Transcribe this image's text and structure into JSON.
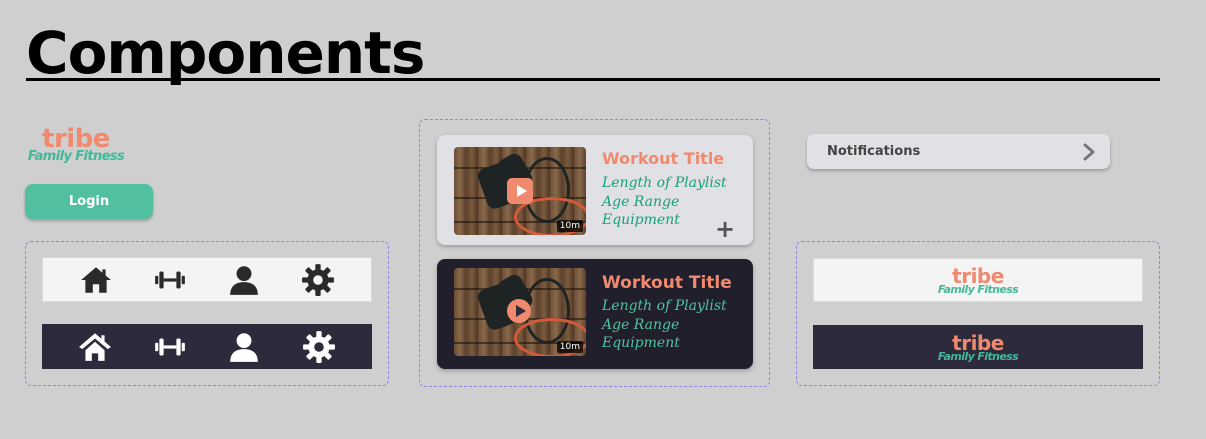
{
  "page": {
    "title": "Components"
  },
  "brand": {
    "name": "tribe",
    "tagline": "Family Fitness"
  },
  "login": {
    "label": "Login"
  },
  "navbar": {
    "items": [
      {
        "icon": "home-icon"
      },
      {
        "icon": "dumbbell-icon"
      },
      {
        "icon": "user-icon"
      },
      {
        "icon": "gear-icon"
      }
    ]
  },
  "workout_cards": [
    {
      "theme": "light",
      "title": "Workout Title",
      "line1": "Length of Playlist",
      "line2": "Age Range",
      "line3": "Equipment",
      "duration": "10m",
      "add_symbol": "+"
    },
    {
      "theme": "dark",
      "title": "Workout Title",
      "line1": "Length of Playlist",
      "line2": "Age Range",
      "line3": "Equipment",
      "duration": "10m"
    }
  ],
  "notifications": {
    "label": "Notifications",
    "icon": "chevron-right-icon"
  },
  "colors": {
    "brand_orange": "#ef8a6f",
    "brand_green": "#43b89a",
    "login_green": "#52bfa0",
    "dark_surface": "#2d2a3c",
    "dashed_border": "#9a7fe6"
  }
}
